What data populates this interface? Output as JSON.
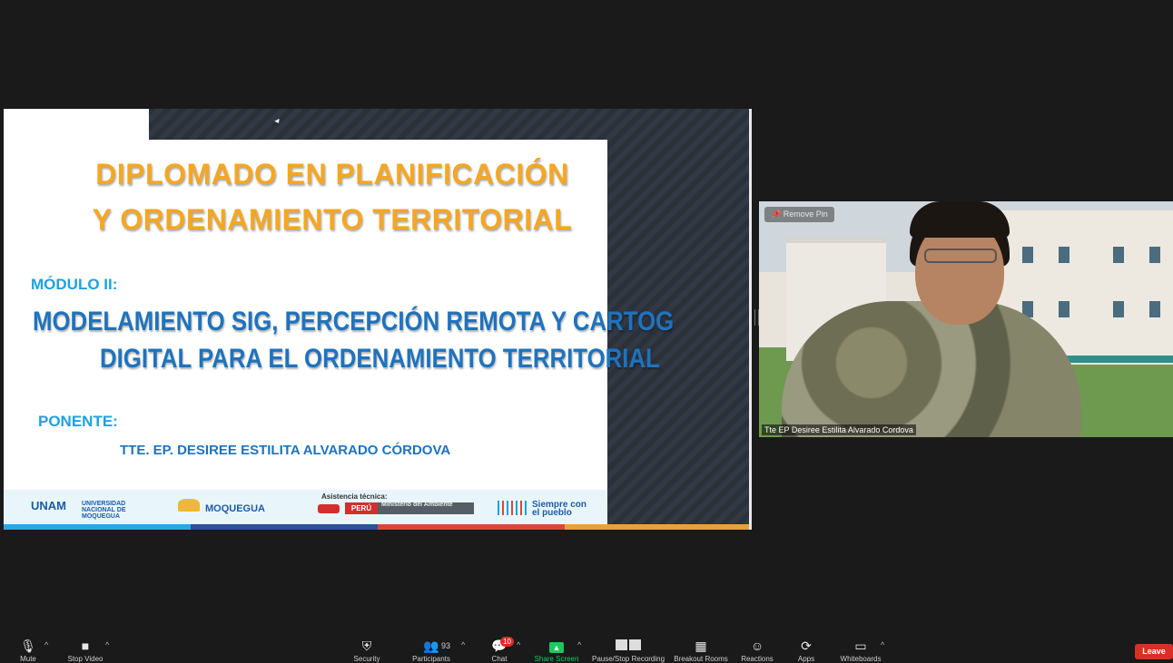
{
  "slide": {
    "title_line1": "DIPLOMADO EN PLANIFICACIÓN",
    "title_line2": "Y ORDENAMIENTO TERRITORIAL",
    "module": "MÓDULO II:",
    "subtitle_line1": "MODELAMIENTO SIG, PERCEPCIÓN REMOTA Y CARTOG",
    "subtitle_line2": "DIGITAL PARA EL ORDENAMIENTO TERRITORIAL",
    "speaker_label": "PONENTE:",
    "speaker_name": "TTE. EP. DESIREE ESTILITA ALVARADO CÓRDOVA",
    "logos": {
      "university": "UNIVERSIDAD NACIONAL DE MOQUEGUA",
      "university_short": "UNAM",
      "region": "MOQUEGUA",
      "assistance": "Asistencia técnica:",
      "country": "PERÚ",
      "ministry": "Ministerio del Ambiente",
      "slogan": "Siempre con el pueblo"
    }
  },
  "video": {
    "remove_pin": "Remove Pin",
    "participant_name": "Tte EP Desiree Estilita Alvarado Cordova"
  },
  "toolbar": {
    "mute": "Mute",
    "stop_video": "Stop Video",
    "security": "Security",
    "participants": "Participants",
    "participants_count": "93",
    "chat": "Chat",
    "chat_badge": "10",
    "share_screen": "Share Screen",
    "pause_recording": "Pause/Stop Recording",
    "breakout_rooms": "Breakout Rooms",
    "reactions": "Reactions",
    "apps": "Apps",
    "whiteboards": "Whiteboards",
    "leave": "Leave"
  },
  "colors": {
    "slide_orange": "#f5a623",
    "slide_blue": "#1e73be",
    "share_green": "#22c55e",
    "leave_red": "#d93025",
    "badge_red": "#e02828"
  }
}
